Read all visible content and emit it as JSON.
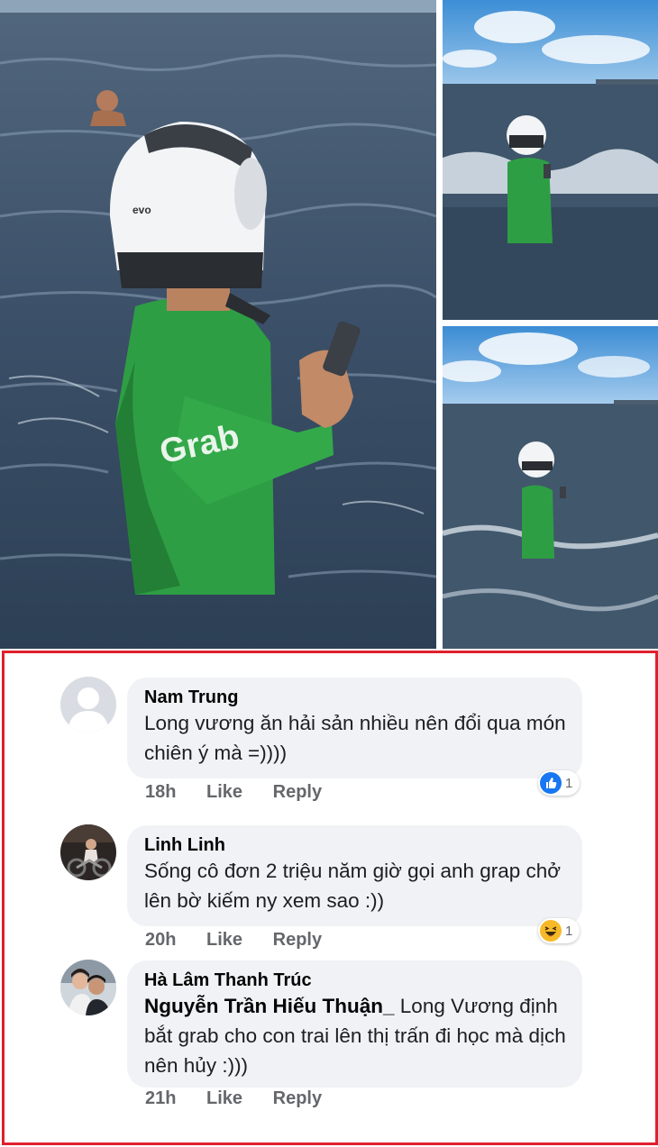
{
  "comments": [
    {
      "author": "Nam Trung",
      "mention": "",
      "text": "Long vương ăn hải sản nhiều nên đổi qua món chiên ý mà =))))",
      "time": "18h",
      "like_label": "Like",
      "reply_label": "Reply",
      "reaction": {
        "type": "like",
        "count": "1"
      }
    },
    {
      "author": "Linh Linh",
      "mention": "",
      "text": "Sống cô đơn 2 triệu năm giờ gọi anh grap chở lên bờ kiếm ny xem sao :))",
      "time": "20h",
      "like_label": "Like",
      "reply_label": "Reply",
      "reaction": {
        "type": "haha",
        "count": "1"
      }
    },
    {
      "author": "Hà Lâm Thanh Trúc",
      "mention": "Nguyễn Trần Hiếu Thuận_",
      "text": " Long Vương định bắt grab cho con trai lên thị trấn đi học mà dịch nên hủy :)))",
      "time": "21h",
      "like_label": "Like",
      "reply_label": "Reply",
      "reaction": null
    }
  ],
  "photos": {
    "shirt_logo": "Grab",
    "helmet_label": "evo"
  },
  "colors": {
    "frame_border": "#e0202e",
    "bubble_bg": "#f0f2f5",
    "like_blue": "#1877f2",
    "haha_yellow": "#f7b928",
    "grab_green": "#2e9e44",
    "sea": "#3d5670"
  }
}
